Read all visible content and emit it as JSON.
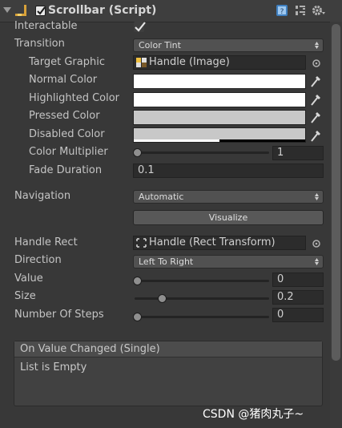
{
  "component": {
    "title": "Scrollbar (Script)",
    "enabled": true,
    "header_icons": [
      "help-book-icon",
      "preset-icon",
      "settings-gear-icon"
    ]
  },
  "fields": {
    "interactable": {
      "label": "Interactable",
      "checked": true
    },
    "transition": {
      "label": "Transition",
      "value": "Color Tint"
    },
    "target_graphic": {
      "label": "Target Graphic",
      "value": "Handle (Image)"
    },
    "normal_color": {
      "label": "Normal Color",
      "color": "#ffffff"
    },
    "highlighted_color": {
      "label": "Highlighted Color",
      "color": "#ffffff"
    },
    "pressed_color": {
      "label": "Pressed Color",
      "color": "#c8c8c8"
    },
    "disabled_color": {
      "label": "Disabled Color",
      "color": "#c8c8c8",
      "alpha": 0.5
    },
    "color_multiplier": {
      "label": "Color Multiplier",
      "value": "1",
      "level": 0
    },
    "fade_duration": {
      "label": "Fade Duration",
      "value": "0.1"
    },
    "navigation": {
      "label": "Navigation",
      "value": "Automatic"
    },
    "visualize": {
      "label": "Visualize"
    },
    "handle_rect": {
      "label": "Handle Rect",
      "value": "Handle (Rect Transform)"
    },
    "direction": {
      "label": "Direction",
      "value": "Left To Right"
    },
    "value": {
      "label": "Value",
      "value": "0",
      "level": 0
    },
    "size": {
      "label": "Size",
      "value": "0.2",
      "level": 0.2
    },
    "number_of_steps": {
      "label": "Number Of Steps",
      "value": "0",
      "level": 0
    }
  },
  "event": {
    "header": "On Value Changed (Single)",
    "body": "List is Empty"
  },
  "watermark": "CSDN @猪肉丸子~"
}
